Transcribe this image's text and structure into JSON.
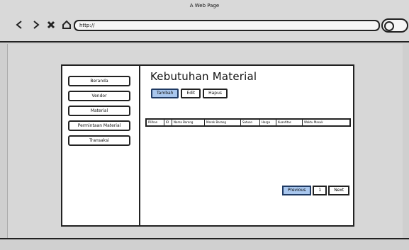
{
  "browser": {
    "title": "A Web Page",
    "url": "http://"
  },
  "sidebar": {
    "items": [
      {
        "label": "Beranda"
      },
      {
        "label": "Vendor"
      },
      {
        "label": "Material"
      },
      {
        "label": "Permintaan Material"
      },
      {
        "label": "Transaksi"
      }
    ]
  },
  "page": {
    "title": "Kebutuhan Material",
    "actions": [
      {
        "label": "Tambah",
        "active": true
      },
      {
        "label": "Edit",
        "active": false
      },
      {
        "label": "Hapus",
        "active": false
      }
    ],
    "table": {
      "headers": [
        "Pilihan",
        "ID",
        "Nama Barang",
        "Merek Barang",
        "Satuan",
        "Harga",
        "Kuantitas",
        "Waktu Masuk"
      ]
    },
    "pagination": {
      "previous": "Previous",
      "page": "1",
      "next": "Next"
    }
  },
  "colors": {
    "accent": "#a9c7ee",
    "accent_border": "#1f3a63"
  }
}
